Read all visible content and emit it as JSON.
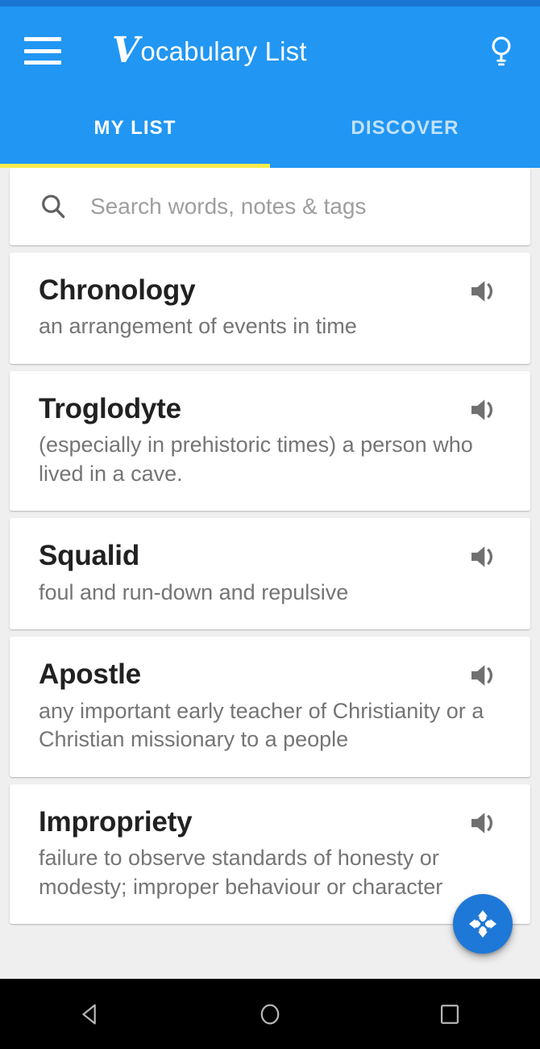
{
  "app": {
    "status_bar_color": "#1976D2",
    "accent_color": "#2196F3",
    "indicator_color": "#F7EB4E",
    "fab_color": "#1E78D7"
  },
  "header": {
    "menu_icon": "hamburger-menu-icon",
    "title_initial": "V",
    "title_rest": "ocabulary List",
    "action_icon": "lightbulb-icon"
  },
  "tabs": [
    {
      "label": "MY LIST",
      "active": true
    },
    {
      "label": "DISCOVER",
      "active": false
    }
  ],
  "search": {
    "icon": "search-icon",
    "placeholder": "Search words, notes & tags",
    "value": ""
  },
  "words": [
    {
      "word": "Chronology",
      "definition": "an arrangement of events in time",
      "speaker_icon": "volume-up-icon"
    },
    {
      "word": "Troglodyte",
      "definition": "(especially in prehistoric times) a person who lived in a cave.",
      "speaker_icon": "volume-up-icon"
    },
    {
      "word": "Squalid",
      "definition": "foul and run-down and repulsive",
      "speaker_icon": "volume-up-icon"
    },
    {
      "word": "Apostle",
      "definition": "any important early teacher of Christianity or a Christian missionary to a people",
      "speaker_icon": "volume-up-icon"
    },
    {
      "word": "Impropriety",
      "definition": "failure to observe standards of honesty or modesty; improper behaviour or character",
      "speaker_icon": "volume-up-icon"
    }
  ],
  "fab": {
    "icon": "scatter-expand-icon"
  },
  "navbar": {
    "back_icon": "triangle-back-icon",
    "home_icon": "circle-home-icon",
    "recents_icon": "square-recents-icon"
  }
}
